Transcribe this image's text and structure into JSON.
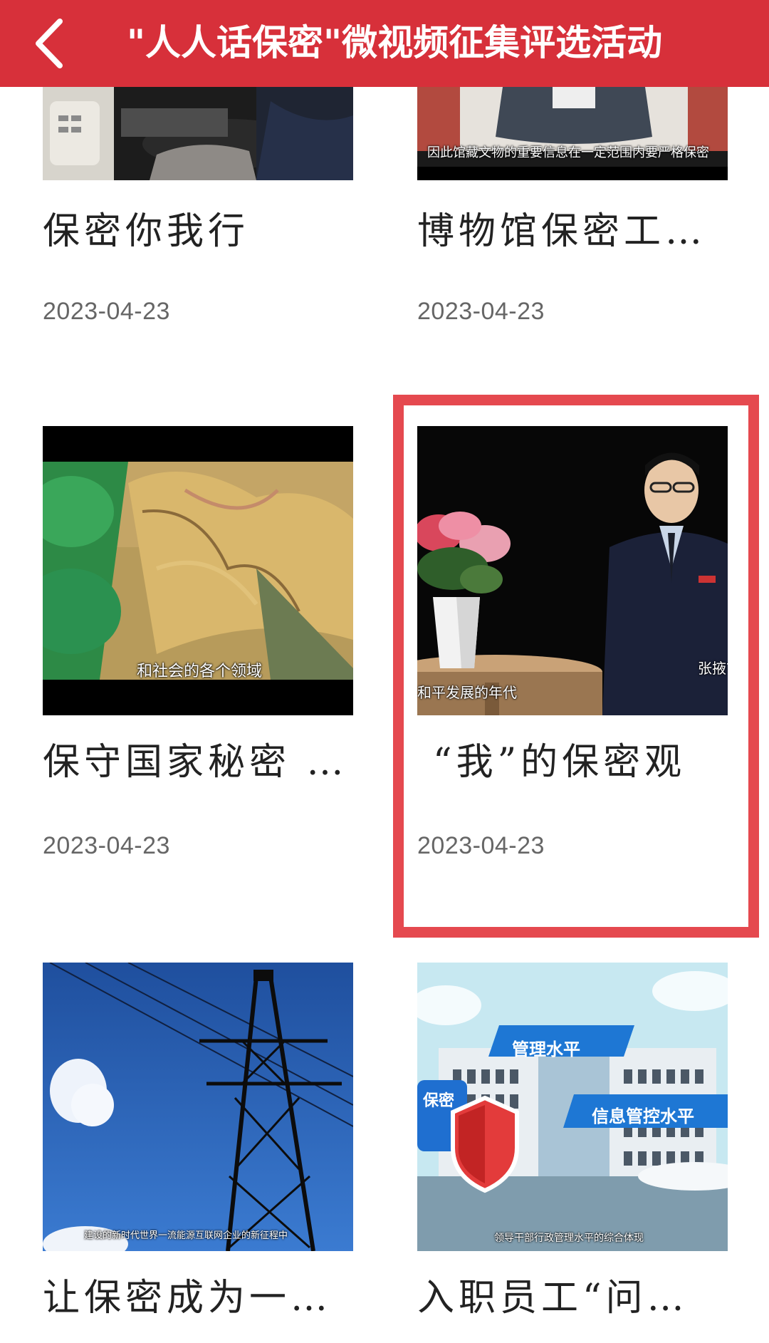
{
  "header": {
    "title": "\"人人话保密\"微视频征集评选活动",
    "back_icon": "chevron-left-icon",
    "background_color": "#d7303a"
  },
  "cards": [
    {
      "title": "保密你我行",
      "date": "2023-04-23",
      "caption": ""
    },
    {
      "title": "博物馆保密工…",
      "date": "2023-04-23",
      "caption": "因此馆藏文物的重要信息在一定范围内要严格保密"
    },
    {
      "title": "保守国家秘密 …",
      "date": "2023-04-23",
      "caption": "和社会的各个领域"
    },
    {
      "title": "“我”的保密观",
      "date": "2023-04-23",
      "caption": "和平发展的年代",
      "caption2": "张掖市",
      "highlighted": true
    },
    {
      "title": "让保密成为一…",
      "date": "",
      "caption": "建设的新时代世界一流能源互联网企业的新征程中"
    },
    {
      "title": "入职员工“问…",
      "date": "",
      "caption": "领导干部行政管理水平的综合体现",
      "label_1": "管理水平",
      "label_2": "信息管控水平",
      "label_3": "保密"
    }
  ],
  "highlight_color": "#e5494f"
}
